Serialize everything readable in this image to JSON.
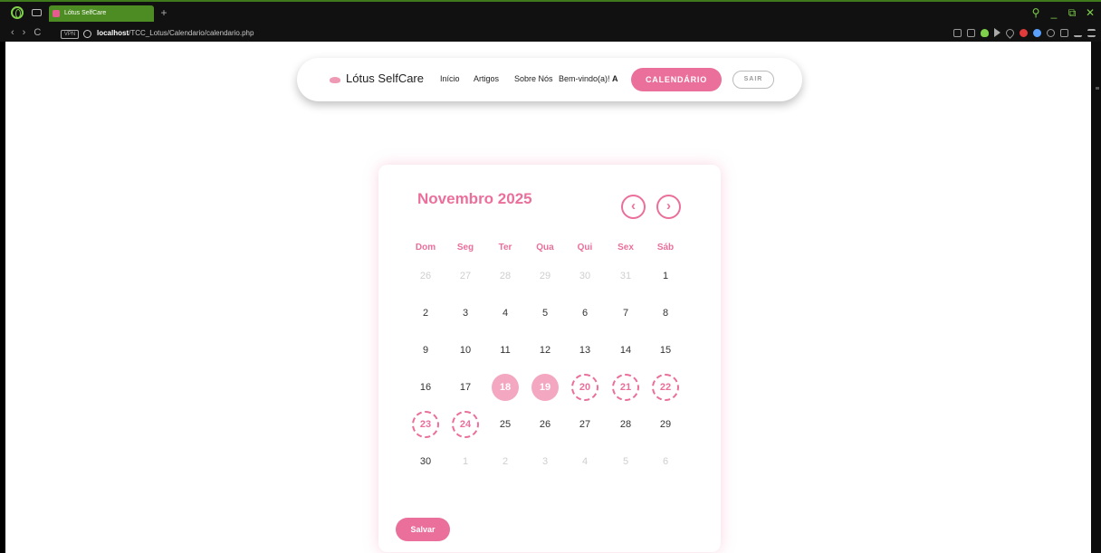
{
  "browser": {
    "tab_title": "Lótus SelfCare",
    "new_tab_label": "+",
    "vpn_label": "VPN",
    "url_host": "localhost",
    "url_path": "/TCC_Lotus/Calendario/calendario.php",
    "nav_back": "‹",
    "nav_forward": "›",
    "nav_reload": "C",
    "win_search": "⚲",
    "win_minimize": "_",
    "win_restore": "⧉",
    "win_close": "✕",
    "accent": "#4c8c22"
  },
  "navbar": {
    "brand": "Lótus SelfCare",
    "links": [
      "Início",
      "Artigos",
      "Sobre Nós"
    ],
    "welcome_text": "Bem-vindo(a)!",
    "welcome_user": "A",
    "calendar_button": "CALENDÁRIO",
    "logout_button": "SAIR"
  },
  "calendar": {
    "month_title": "Novembro 2025",
    "prev_icon": "‹",
    "next_icon": "›",
    "weekdays": [
      "Dom",
      "Seg",
      "Ter",
      "Qua",
      "Qui",
      "Sex",
      "Sáb"
    ],
    "weeks": [
      [
        {
          "d": "26",
          "s": "muted"
        },
        {
          "d": "27",
          "s": "muted"
        },
        {
          "d": "28",
          "s": "muted"
        },
        {
          "d": "29",
          "s": "muted"
        },
        {
          "d": "30",
          "s": "muted"
        },
        {
          "d": "31",
          "s": "muted"
        },
        {
          "d": "1",
          "s": "normal"
        }
      ],
      [
        {
          "d": "2",
          "s": "normal"
        },
        {
          "d": "3",
          "s": "normal"
        },
        {
          "d": "4",
          "s": "normal"
        },
        {
          "d": "5",
          "s": "normal"
        },
        {
          "d": "6",
          "s": "normal"
        },
        {
          "d": "7",
          "s": "normal"
        },
        {
          "d": "8",
          "s": "normal"
        }
      ],
      [
        {
          "d": "9",
          "s": "normal"
        },
        {
          "d": "10",
          "s": "normal"
        },
        {
          "d": "11",
          "s": "normal"
        },
        {
          "d": "12",
          "s": "normal"
        },
        {
          "d": "13",
          "s": "normal"
        },
        {
          "d": "14",
          "s": "normal"
        },
        {
          "d": "15",
          "s": "normal"
        }
      ],
      [
        {
          "d": "16",
          "s": "normal"
        },
        {
          "d": "17",
          "s": "normal"
        },
        {
          "d": "18",
          "s": "selected"
        },
        {
          "d": "19",
          "s": "selected"
        },
        {
          "d": "20",
          "s": "range"
        },
        {
          "d": "21",
          "s": "range"
        },
        {
          "d": "22",
          "s": "range"
        }
      ],
      [
        {
          "d": "23",
          "s": "range"
        },
        {
          "d": "24",
          "s": "range"
        },
        {
          "d": "25",
          "s": "normal"
        },
        {
          "d": "26",
          "s": "normal"
        },
        {
          "d": "27",
          "s": "normal"
        },
        {
          "d": "28",
          "s": "normal"
        },
        {
          "d": "29",
          "s": "normal"
        }
      ],
      [
        {
          "d": "30",
          "s": "normal"
        },
        {
          "d": "1",
          "s": "muted"
        },
        {
          "d": "2",
          "s": "muted"
        },
        {
          "d": "3",
          "s": "muted"
        },
        {
          "d": "4",
          "s": "muted"
        },
        {
          "d": "5",
          "s": "muted"
        },
        {
          "d": "6",
          "s": "muted"
        }
      ]
    ],
    "save_button": "Salvar",
    "accent": "#ea6f9b",
    "selected_color": "#f3a7c1"
  }
}
